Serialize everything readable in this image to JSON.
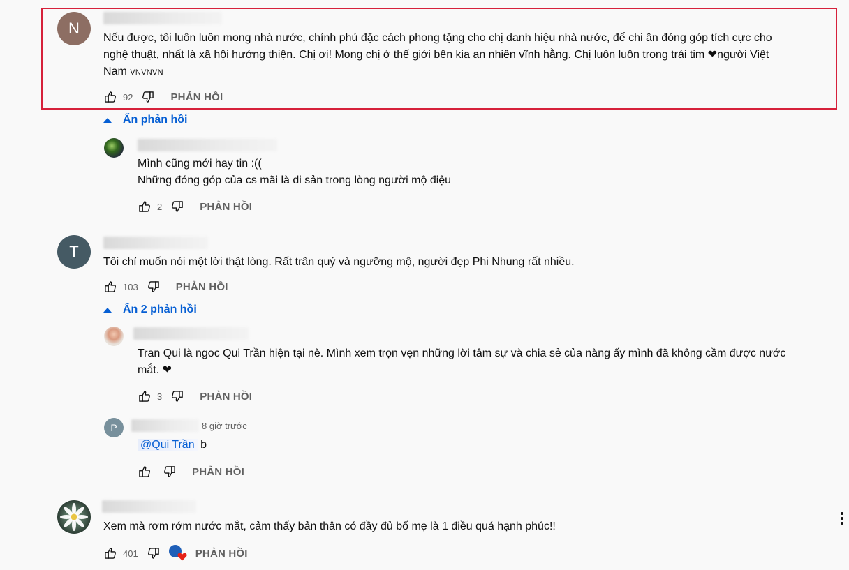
{
  "comments": [
    {
      "avatar_letter": "N",
      "avatar_color": "#8d6e63",
      "text_lines": [
        "Nếu được, tôi luôn luôn mong nhà nước, chính phủ đặc cách phong tặng cho chị danh hiệu nhà nước, để chi ân đóng góp tích cực cho",
        "nghệ thuật, nhất là xã hội hướng thiện. Chị ơi! Mong chị ở thế giới bên kia an nhiên vĩnh hằng. Chị luôn luôn trong trái tim ❤người Việt",
        "Nam"
      ],
      "text_suffix_small": "VNVNVN",
      "likes": "92",
      "reply_label": "PHẢN HỒI",
      "toggle_label": "Ẩn phản hồi",
      "replies": [
        {
          "text_lines": [
            "Mình cũng mới hay tin :((",
            "Những đóng góp của cs mãi là di sản trong lòng người mộ điệu"
          ],
          "likes": "2",
          "reply_label": "PHẢN HỒI"
        }
      ]
    },
    {
      "avatar_letter": "T",
      "avatar_color": "#455a64",
      "text_lines": [
        "Tôi chỉ muốn nói một lời thật lòng. Rất trân quý và ngưỡng mộ, người đẹp Phi Nhung rất nhiều."
      ],
      "likes": "103",
      "reply_label": "PHẢN HỒI",
      "toggle_label": "Ẩn 2 phản hồi",
      "replies": [
        {
          "text_lines": [
            "Tran Qui là ngoc Qui Trần hiện tại nè. Mình xem trọn vẹn những lời tâm sự và chia sẻ của nàng ấy mình đã không cầm được nước",
            "mắt. ❤"
          ],
          "likes": "3",
          "reply_label": "PHẢN HỒI"
        },
        {
          "avatar_letter": "P",
          "avatar_color": "#78909c",
          "time": "8 giờ trước",
          "mention": "@Qui Trần",
          "text": "b",
          "likes": "",
          "reply_label": "PHẢN HỒI"
        }
      ]
    },
    {
      "text_lines": [
        "Xem mà rơm rớm nước mắt, cảm thấy bản thân có đầy đủ bố mẹ là 1 điều quá hạnh phúc!!"
      ],
      "likes": "401",
      "reply_label": "PHẢN HỒI"
    }
  ],
  "colors": {
    "highlight": "#d6213b",
    "link": "#065fd4",
    "heart": "#e62117"
  },
  "icons": [
    "thumb-up-icon",
    "thumb-down-icon",
    "creator-heart-icon",
    "more-vert-icon",
    "expand-less-icon"
  ]
}
